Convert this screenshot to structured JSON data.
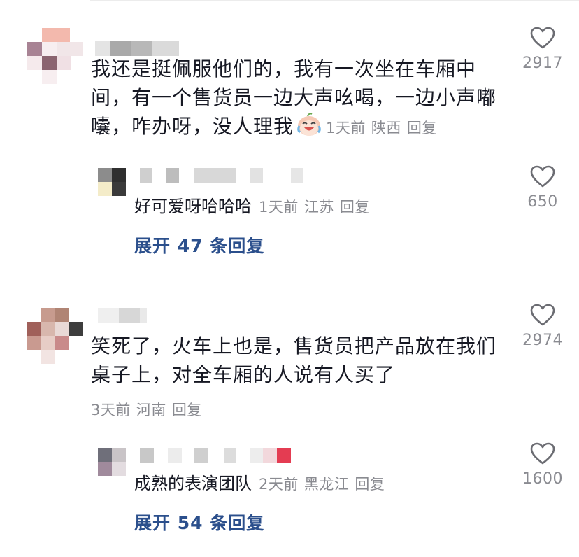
{
  "comments": [
    {
      "text_line1": "我还是挺佩服他们的，我有一次坐在车厢中",
      "text_line2": "间，有一个售货员一边大声吆喝，一边小声嘟",
      "text_line3": "囔，咋办呀，没人理我",
      "emoji": "crying-laughing-emoji",
      "time": "1天前",
      "location": "陕西",
      "reply_label": "回复",
      "likes": "2917",
      "replies": [
        {
          "text": "好可爱呀哈哈哈",
          "time": "1天前",
          "location": "江苏",
          "reply_label": "回复",
          "likes": "650"
        }
      ],
      "expand_label": "展开 47 条回复"
    },
    {
      "text_line1": "笑死了，火车上也是，售货员把产品放在我们",
      "text_line2": "桌子上，对全车厢的人说有人买了",
      "time": "3天前",
      "location": "河南",
      "reply_label": "回复",
      "likes": "2974",
      "replies": [
        {
          "text": "成熟的表演团队",
          "time": "2天前",
          "location": "黑龙江",
          "reply_label": "回复",
          "likes": "1600"
        }
      ],
      "expand_label": "展开 54 条回复"
    }
  ],
  "colors": {
    "text": "#161823",
    "meta": "#8a8b91",
    "expand": "#2b4f8c",
    "heart_stroke": "#6b6c72"
  }
}
